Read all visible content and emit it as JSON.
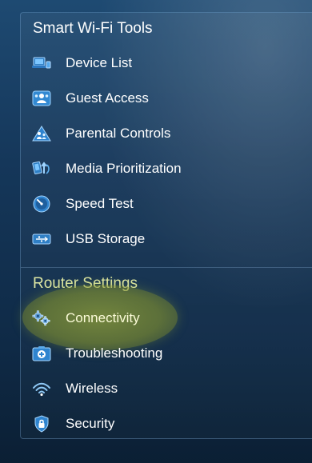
{
  "colors": {
    "background": "#15375a",
    "text": "#ffffff",
    "router_heading": "#dfe8a4",
    "highlight": "#96a537",
    "icon_blue": "#4aa0e0"
  },
  "smart_wifi_tools": {
    "title": "Smart Wi-Fi Tools",
    "items": [
      {
        "label": "Device List",
        "icon": "device-list-icon"
      },
      {
        "label": "Guest Access",
        "icon": "guest-access-icon"
      },
      {
        "label": "Parental Controls",
        "icon": "parental-controls-icon"
      },
      {
        "label": "Media Prioritization",
        "icon": "media-prioritization-icon"
      },
      {
        "label": "Speed Test",
        "icon": "speed-test-icon"
      },
      {
        "label": "USB Storage",
        "icon": "usb-storage-icon"
      }
    ]
  },
  "router_settings": {
    "title": "Router Settings",
    "items": [
      {
        "label": "Connectivity",
        "icon": "gear-icon",
        "highlighted": true
      },
      {
        "label": "Troubleshooting",
        "icon": "troubleshooting-icon"
      },
      {
        "label": "Wireless",
        "icon": "wireless-icon"
      },
      {
        "label": "Security",
        "icon": "shield-icon"
      }
    ]
  }
}
